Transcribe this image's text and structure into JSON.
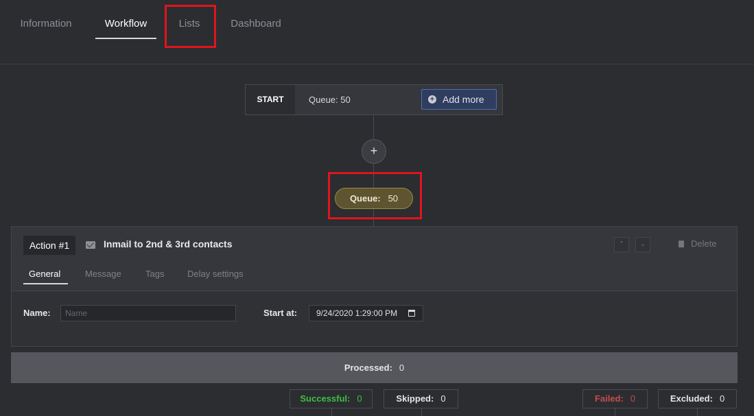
{
  "tabs": [
    {
      "label": "Information"
    },
    {
      "label": "Workflow"
    },
    {
      "label": "Lists"
    },
    {
      "label": "Dashboard"
    }
  ],
  "start_node": {
    "label": "START",
    "queue_text": "Queue: 50",
    "add_more_label": "Add more"
  },
  "plus_label": "+",
  "queue_pill": {
    "label": "Queue:",
    "value": "50"
  },
  "action": {
    "number": "Action #1",
    "title": "Inmail to 2nd & 3rd contacts",
    "delete_label": "Delete",
    "subtabs": [
      {
        "label": "General"
      },
      {
        "label": "Message"
      },
      {
        "label": "Tags"
      },
      {
        "label": "Delay settings"
      }
    ],
    "name_label": "Name:",
    "name_placeholder": "Name",
    "name_value": "",
    "start_at_label": "Start at:",
    "start_at_value": "9/24/2020 1:29:00 PM"
  },
  "processed": {
    "label": "Processed:",
    "value": "0"
  },
  "stats": [
    {
      "label": "Successful:",
      "value": "0",
      "color": "#3fbf3f"
    },
    {
      "label": "Skipped:",
      "value": "0",
      "color": "#e4e5e7"
    },
    {
      "label": "Failed:",
      "value": "0",
      "color": "#c94b4b"
    },
    {
      "label": "Excluded:",
      "value": "0",
      "color": "#e4e5e7"
    }
  ],
  "colors": {
    "background": "#2b2d31",
    "accent_blue": "#4f6fb8",
    "queue_gold": "#9c8a3d",
    "annotation_red": "#e0141c"
  }
}
